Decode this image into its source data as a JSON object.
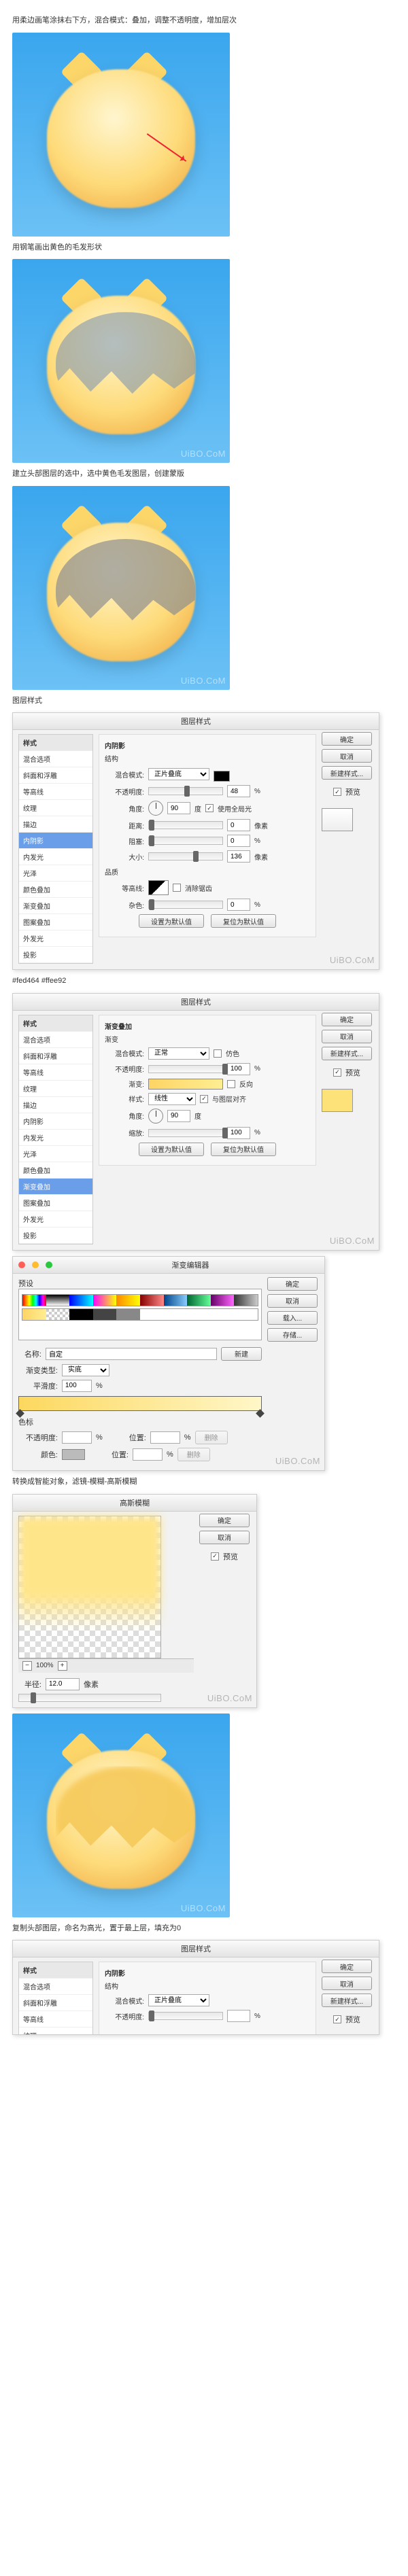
{
  "watermark": "UiBO.CoM",
  "steps": {
    "s1": "用柔边画笔涂抹右下方，混合模式：叠加，调整不透明度，增加层次",
    "s2": "用钢笔画出黄色的毛发形状",
    "s3": "建立头部图层的选中，选中黄色毛发图层，创建蒙版",
    "s4": "图层样式",
    "s5": "#fed464  #ffee92",
    "s6": "转换成智能对象，滤镜-模糊-高斯模糊",
    "s7": "复制头部图层，命名为高光，置于最上层，填充为0"
  },
  "layerStyle": {
    "dialogTitle": "图层样式",
    "sideHeader": "样式",
    "items": [
      "混合选项",
      "斜面和浮雕",
      "等高线",
      "纹理",
      "描边",
      "内阴影",
      "内发光",
      "光泽",
      "颜色叠加",
      "渐变叠加",
      "图案叠加",
      "外发光",
      "投影"
    ],
    "buttons": {
      "ok": "确定",
      "cancel": "取消",
      "newStyle": "新建样式...",
      "preview": "预览"
    },
    "innerShadow": {
      "section": "内阴影",
      "structure": "结构",
      "blendMode": "混合模式:",
      "blendModeVal": "正片叠底",
      "opacity": "不透明度:",
      "opacityVal": "48",
      "pct": "%",
      "angle": "角度:",
      "angleVal": "90",
      "deg": "度",
      "globalLight": "使用全局光",
      "distance": "距离:",
      "distanceVal": "0",
      "px": "像素",
      "choke": "阻塞:",
      "chokeVal": "0",
      "size": "大小:",
      "sizeVal": "136",
      "quality": "品质",
      "contour": "等高线:",
      "antiAlias": "消除锯齿",
      "noise": "杂色:",
      "noiseVal": "0",
      "defaultBtn": "设置为默认值",
      "resetBtn": "复位为默认值"
    },
    "gradOverlay": {
      "section": "渐变叠加",
      "gradientGroup": "渐变",
      "blendMode": "混合模式:",
      "blendModeVal": "正常",
      "dither": "仿色",
      "opacity": "不透明度:",
      "opacityVal": "100",
      "gradient": "渐变:",
      "reverse": "反向",
      "style": "样式:",
      "styleVal": "线性",
      "alignLayer": "与图层对齐",
      "angle": "角度:",
      "angleVal": "90",
      "scale": "缩放:",
      "scaleVal": "100",
      "defaultBtn": "设置为默认值",
      "resetBtn": "复位为默认值"
    }
  },
  "gradientEditor": {
    "title": "渐变编辑器",
    "presets": "预设",
    "nameLabel": "名称:",
    "nameVal": "自定",
    "typeLabel": "渐变类型:",
    "typeVal": "实底",
    "smoothLabel": "平滑度:",
    "smoothVal": "100",
    "pct": "%",
    "stopsHeader": "色标",
    "opacityLabel": "不透明度:",
    "posLabel": "位置:",
    "colorLabel": "颜色:",
    "delete": "删除",
    "buttons": {
      "ok": "确定",
      "cancel": "取消",
      "load": "载入...",
      "save": "存储...",
      "new": "新建"
    }
  },
  "gauss": {
    "title": "高斯模糊",
    "ok": "确定",
    "cancel": "取消",
    "preview": "预览",
    "zoom": "100%",
    "radiusLabel": "半径:",
    "radiusVal": "12.0",
    "px": "像素"
  }
}
